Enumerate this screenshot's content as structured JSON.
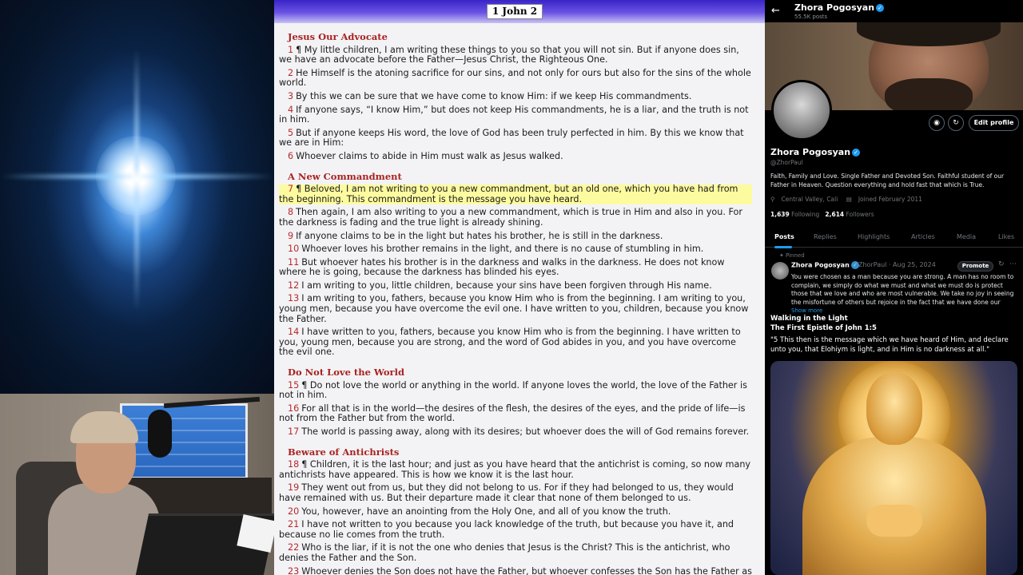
{
  "bible": {
    "chapter_title": "1 John 2",
    "sections": [
      {
        "heading": "Jesus Our Advocate",
        "verses": [
          {
            "n": "1",
            "text": "¶ My little children, I am writing these things to you so that you will not sin. But if anyone does sin, we have an advocate before the Father—Jesus Christ, the Righteous One."
          },
          {
            "n": "2",
            "text": "He Himself is the atoning sacrifice for our sins, and not only for ours but also for the sins of the whole world."
          },
          {
            "n": "3",
            "text": "By this we can be sure that we have come to know Him: if we keep His commandments."
          },
          {
            "n": "4",
            "text": "If anyone says, “I know Him,” but does not keep His commandments, he is a liar, and the truth is not in him."
          },
          {
            "n": "5",
            "text": "But if anyone keeps His word, the love of God has been truly perfected in him. By this we know that we are in Him:"
          },
          {
            "n": "6",
            "text": "Whoever claims to abide in Him must walk as Jesus walked."
          }
        ]
      },
      {
        "heading": "A New Commandment",
        "verses": [
          {
            "n": "7",
            "text": "¶ Beloved, I am not writing to you a new commandment, but an old one, which you have had from the beginning. This commandment is the message you have heard."
          },
          {
            "n": "8",
            "text": "Then again, I am also writing to you a new commandment, which is true in Him and also in you. For the darkness is fading and the true light is already shining."
          },
          {
            "n": "9",
            "text": "If anyone claims to be in the light but hates his brother, he is still in the darkness."
          },
          {
            "n": "10",
            "text": "Whoever loves his brother remains in the light, and there is no cause of stumbling in him."
          },
          {
            "n": "11",
            "text": "But whoever hates his brother is in the darkness and walks in the darkness. He does not know where he is going, because the darkness has blinded his eyes."
          },
          {
            "n": "12",
            "text": "I am writing to you, little children, because your sins have been forgiven through His name."
          },
          {
            "n": "13",
            "text": "I am writing to you, fathers, because you know Him who is from the beginning. I am writing to you, young men, because you have overcome the evil one. I have written to you, children, because you know the Father."
          },
          {
            "n": "14",
            "text": "I have written to you, fathers, because you know Him who is from the beginning. I have written to you, young men, because you are strong, and the word of God abides in you, and you have overcome the evil one."
          }
        ]
      },
      {
        "heading": "Do Not Love the World",
        "verses": [
          {
            "n": "15",
            "text": "¶ Do not love the world or anything in the world. If anyone loves the world, the love of the Father is not in him."
          },
          {
            "n": "16",
            "text": "For all that is in the world—the desires of the flesh, the desires of the eyes, and the pride of life—is not from the Father but from the world."
          },
          {
            "n": "17",
            "text": "The world is passing away, along with its desires; but whoever does the will of God remains forever."
          }
        ]
      },
      {
        "heading": "Beware of Antichrists",
        "verses": [
          {
            "n": "18",
            "text": "¶ Children, it is the last hour; and just as you have heard that the antichrist is coming, so now many antichrists have appeared. This is how we know it is the last hour."
          },
          {
            "n": "19",
            "text": "They went out from us, but they did not belong to us. For if they had belonged to us, they would have remained with us. But their departure made it clear that none of them belonged to us."
          },
          {
            "n": "20",
            "text": "You, however, have an anointing from the Holy One, and all of you know the truth."
          },
          {
            "n": "21",
            "text": "I have not written to you because you lack knowledge of the truth, but because you have it, and because no lie comes from the truth."
          },
          {
            "n": "22",
            "text": "Who is the liar, if it is not the one who denies that Jesus is the Christ? This is the antichrist, who denies the Father and the Son."
          },
          {
            "n": "23",
            "text": "Whoever denies the Son does not have the Father, but whoever confesses the Son has the Father as"
          }
        ]
      }
    ],
    "highlighted_verse": "7",
    "colors": {
      "heading": "#a8231f",
      "verse_number": "#b52a2a",
      "highlight": "#fdfba0",
      "header_bar": "#3a24c8"
    }
  },
  "profile": {
    "back_icon": "arrow-left-icon",
    "top_name": "Zhora Pogosyan",
    "top_posts": "55.5K posts",
    "display_name": "Zhora Pogosyan",
    "handle": "@ZhorPaul",
    "camera_icon": "camera-icon",
    "subscribe_icon": "bell-icon",
    "edit_profile": "Edit profile",
    "bio": "Faith, Family and Love. Single Father and Devoted Son. Faithful student of our Father in Heaven. Question everything and hold fast that which is True.",
    "location": "Central Valley, Cali",
    "joined": "Joined February 2011",
    "following_count": "1,639",
    "following_label": "Following",
    "followers_count": "2,614",
    "followers_label": "Followers",
    "tabs": [
      "Posts",
      "Replies",
      "Highlights",
      "Articles",
      "Media",
      "Likes"
    ],
    "pinned_label": "Pinned",
    "post": {
      "author": "Zhora Pogosyan",
      "handle_date": "@ZhorPaul · Aug 25, 2024",
      "promote": "Promote",
      "text": "You were chosen as a man because you are strong. A man has no room to complain, we simply do what we must and what we must do is protect those that we love and who are most vulnerable. We take no joy in seeing the misfortune of others but rejoice in the fact that we have done our",
      "show_more": "Show more",
      "card_title1": "Walking in the Light",
      "card_title2": "The First Epistle of John 1:5",
      "card_quote": "\"5 This then is the message which we have heard of Him, and declare unto you, that Elohiym is light, and in Him is no darkness at all.\""
    },
    "colors": {
      "accent": "#1d9bf0",
      "muted": "#71767b",
      "background": "#000000"
    }
  }
}
